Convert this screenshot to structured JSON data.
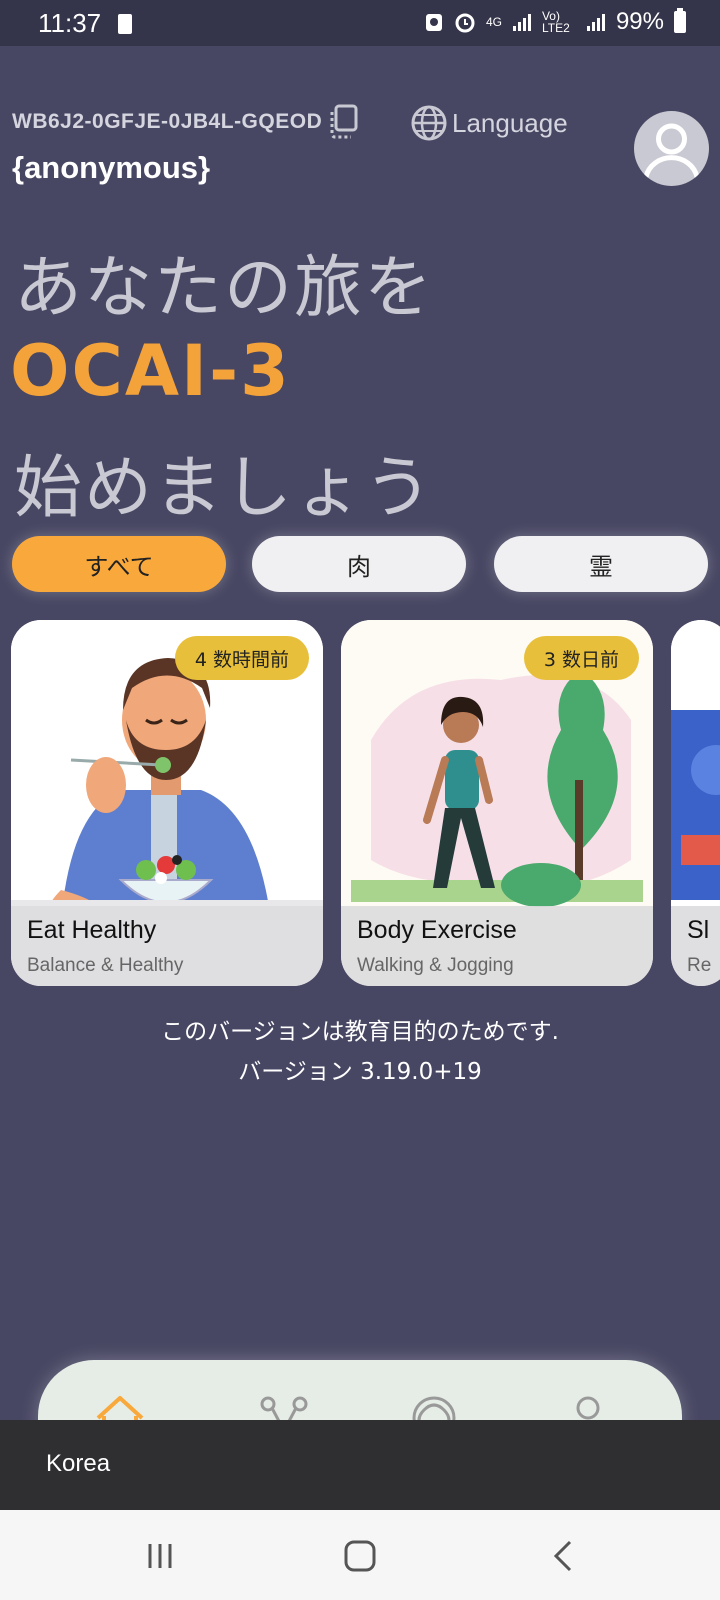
{
  "status_bar": {
    "time": "11:37",
    "network": "4G",
    "volte": "Vo) LTE2",
    "battery": "99%"
  },
  "header": {
    "account_id": "WB6J2-0GFJE-0JB4L-GQEOD",
    "language_label": "Language",
    "username": "{anonymous}"
  },
  "hero": {
    "line1": "あなたの旅を",
    "brand": "OCAI-3",
    "line3": "始めましょう"
  },
  "filters": [
    {
      "label": "すべて",
      "active": true
    },
    {
      "label": "肉",
      "active": false
    },
    {
      "label": "霊",
      "active": false
    }
  ],
  "cards": [
    {
      "title": "Eat Healthy",
      "subtitle": "Balance & Healthy",
      "badge": "4 数時間前"
    },
    {
      "title": "Body Exercise",
      "subtitle": "Walking & Jogging",
      "badge": "3 数日前"
    },
    {
      "title": "Sl",
      "subtitle": "Re"
    }
  ],
  "info": {
    "line1": "このバージョンは教育目的のためです.",
    "line2": "バージョン 3.19.0+19"
  },
  "snackbar": {
    "message": "Korea"
  },
  "colors": {
    "background": "#484763",
    "accent": "#f9a93b",
    "badge": "#e7bf3b",
    "nav_bg": "#e6ede6"
  },
  "icons": {
    "copy": "copy-icon",
    "language": "globe-icon",
    "avatar": "person-icon",
    "nav": [
      "home-icon",
      "network-icon",
      "ai-icon",
      "profile-icon"
    ]
  }
}
